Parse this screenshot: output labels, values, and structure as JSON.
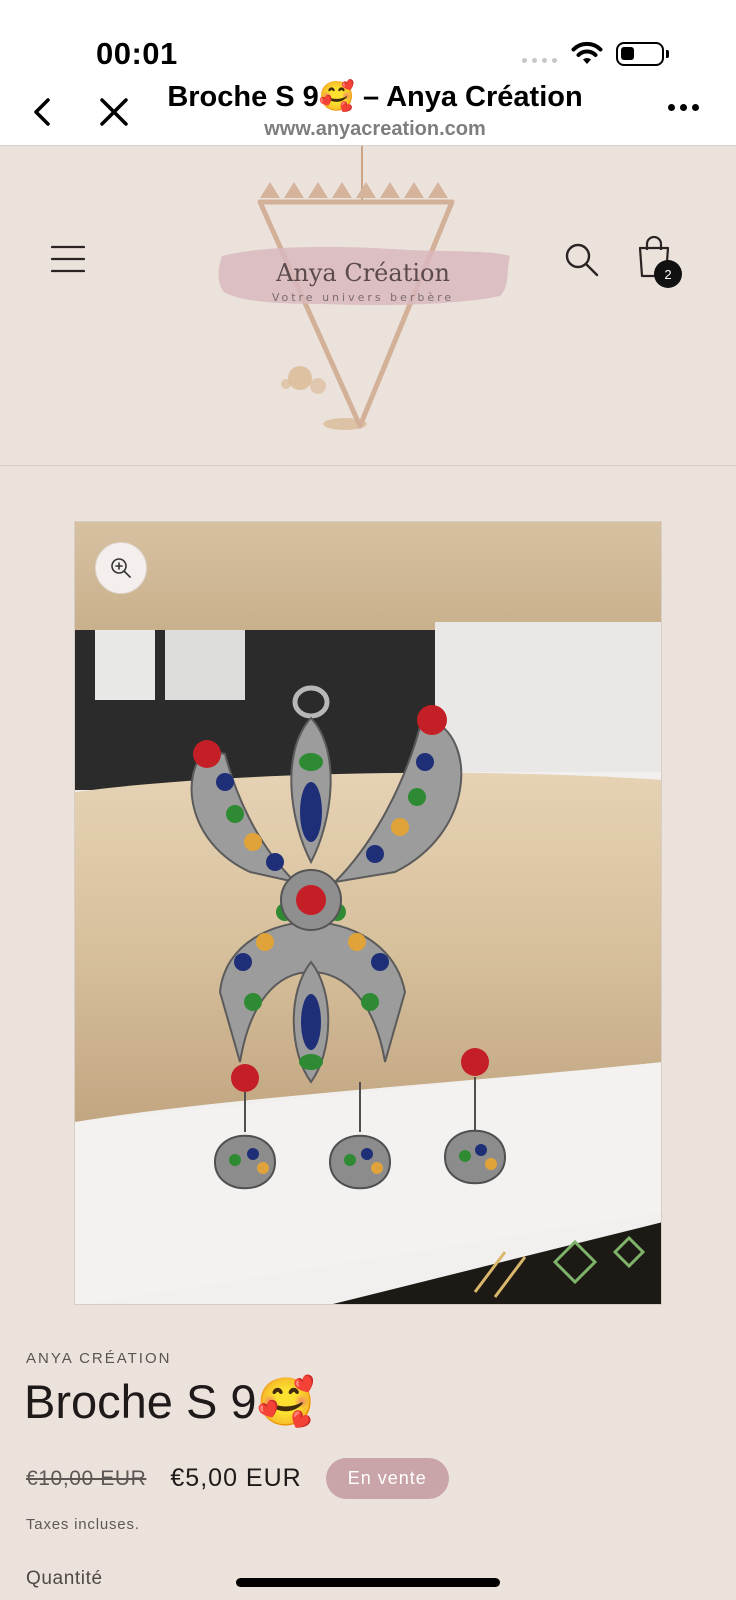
{
  "status_bar": {
    "time": "00:01"
  },
  "browser": {
    "title": "Broche S 9🥰 – Anya Création",
    "url": "www.anyacreation.com",
    "icons": {
      "back": "back-arrow-icon",
      "close": "close-icon",
      "more": "more-dots-icon"
    }
  },
  "header": {
    "logo_title": "Anya Création",
    "logo_tagline": "Votre univers berbère",
    "cart_count": "2",
    "icons": {
      "menu": "hamburger-menu-icon",
      "search": "search-icon",
      "cart": "shopping-bag-icon",
      "zoom": "zoom-in-icon"
    }
  },
  "product": {
    "vendor": "ANYA CRÉATION",
    "title": "Broche S 9🥰",
    "compare_price": "€10,00 EUR",
    "price": "€5,00 EUR",
    "badge": "En vente",
    "tax_note": "Taxes incluses.",
    "quantity_label": "Quantité"
  },
  "colors": {
    "page_bg": "#ece2dc",
    "badge_bg": "#c9a5aa",
    "logo_accent": "#cfa98f"
  }
}
